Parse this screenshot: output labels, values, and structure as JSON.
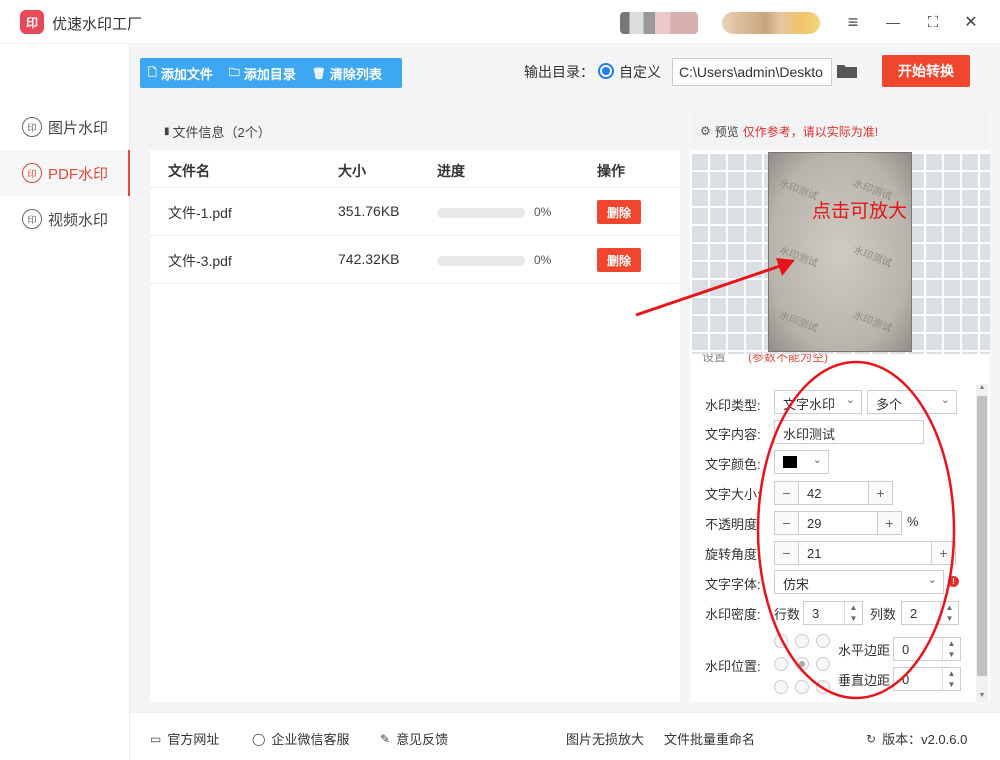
{
  "app": {
    "title": "优速水印工厂",
    "logo_text": "印"
  },
  "window": {
    "menu_icon": "≡",
    "minimize_icon": "—",
    "maximize_icon": "⛶",
    "close_icon": "✕"
  },
  "sidebar": {
    "items": [
      {
        "label": "图片水印",
        "icon": "印",
        "active": false
      },
      {
        "label": "PDF水印",
        "icon": "印",
        "active": true
      },
      {
        "label": "视频水印",
        "icon": "印",
        "active": false
      }
    ]
  },
  "toolbar": {
    "add_file": "添加文件",
    "add_folder": "添加目录",
    "clear_list": "清除列表"
  },
  "output": {
    "label": "输出目录：",
    "option": "自定义",
    "path": "C:\\Users\\admin\\Deskto"
  },
  "start_button": "开始转换",
  "file_panel": {
    "header": "文件信息（2个）",
    "columns": {
      "name": "文件名",
      "size": "大小",
      "progress": "进度",
      "action": "操作"
    },
    "rows": [
      {
        "name": "文件-1.pdf",
        "size": "351.76KB",
        "progress": "0%",
        "action": "删除"
      },
      {
        "name": "文件-3.pdf",
        "size": "742.32KB",
        "progress": "0%",
        "action": "删除"
      }
    ]
  },
  "preview": {
    "title": "预览",
    "note": "仅作参考，请以实际为准!",
    "watermark_text": "水印测试",
    "zoom_hint": "点击可放大"
  },
  "settings": {
    "header_left": "设置",
    "header_right": "(参数不能为空)",
    "type_label": "水印类型:",
    "type_value": "文字水印",
    "mode_value": "多个",
    "content_label": "文字内容:",
    "content_value": "水印测试",
    "color_label": "文字颜色:",
    "color_value": "#000000",
    "size_label": "文字大小:",
    "size_value": "42",
    "opacity_label": "不透明度:",
    "opacity_value": "29",
    "opacity_unit": "%",
    "rotation_label": "旋转角度:",
    "rotation_value": "21",
    "font_label": "文字字体:",
    "font_value": "仿宋",
    "density_label": "水印密度:",
    "rows_label": "行数",
    "rows_value": "3",
    "cols_label": "列数",
    "cols_value": "2",
    "position_label": "水印位置:",
    "hmargin_label": "水平边距",
    "hmargin_value": "0",
    "vmargin_label": "垂直边距",
    "vmargin_value": "0"
  },
  "footer": {
    "website": "官方网址",
    "wechat": "企业微信客服",
    "feedback": "意见反馈",
    "lossless": "图片无损放大",
    "rename": "文件批量重命名",
    "version": "版本：v2.0.6.0"
  },
  "colors": {
    "accent_red": "#f0462d",
    "toolbar_blue": "#3ea7f2",
    "annotation_red": "#e8141b"
  }
}
